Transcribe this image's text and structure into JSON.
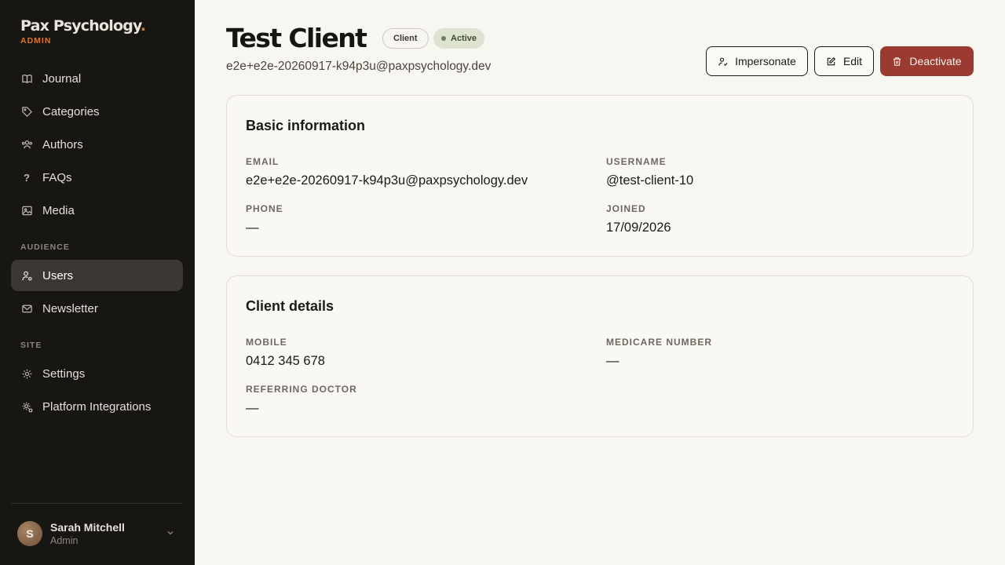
{
  "brand": {
    "name": "Pax Psychology",
    "dot": ".",
    "sub": "ADMIN"
  },
  "nav": {
    "journal": "Journal",
    "categories": "Categories",
    "authors": "Authors",
    "faqs": "FAQs",
    "media": "Media",
    "audience_label": "AUDIENCE",
    "users": "Users",
    "newsletter": "Newsletter",
    "site_label": "SITE",
    "settings": "Settings",
    "platform_integrations": "Platform Integrations"
  },
  "current_user": {
    "initial": "S",
    "name": "Sarah Mitchell",
    "role": "Admin"
  },
  "header": {
    "title": "Test Client",
    "role_badge": "Client",
    "status_badge": "Active",
    "email": "e2e+e2e-20260917-k94p3u@paxpsychology.dev"
  },
  "actions": {
    "impersonate": "Impersonate",
    "edit": "Edit",
    "deactivate": "Deactivate"
  },
  "basic_info": {
    "title": "Basic information",
    "email_label": "EMAIL",
    "email_value": "e2e+e2e-20260917-k94p3u@paxpsychology.dev",
    "username_label": "USERNAME",
    "username_value": "@test-client-10",
    "phone_label": "PHONE",
    "phone_value": "—",
    "joined_label": "JOINED",
    "joined_value": "17/09/2026"
  },
  "client_details": {
    "title": "Client details",
    "mobile_label": "MOBILE",
    "mobile_value": "0412 345 678",
    "medicare_label": "MEDICARE NUMBER",
    "medicare_value": "—",
    "doctor_label": "REFERRING DOCTOR",
    "doctor_value": "—"
  },
  "colors": {
    "sidebar_bg": "#181612",
    "accent": "#d9772f",
    "danger": "#9b3a30",
    "active_badge_bg": "#dde3d0"
  }
}
